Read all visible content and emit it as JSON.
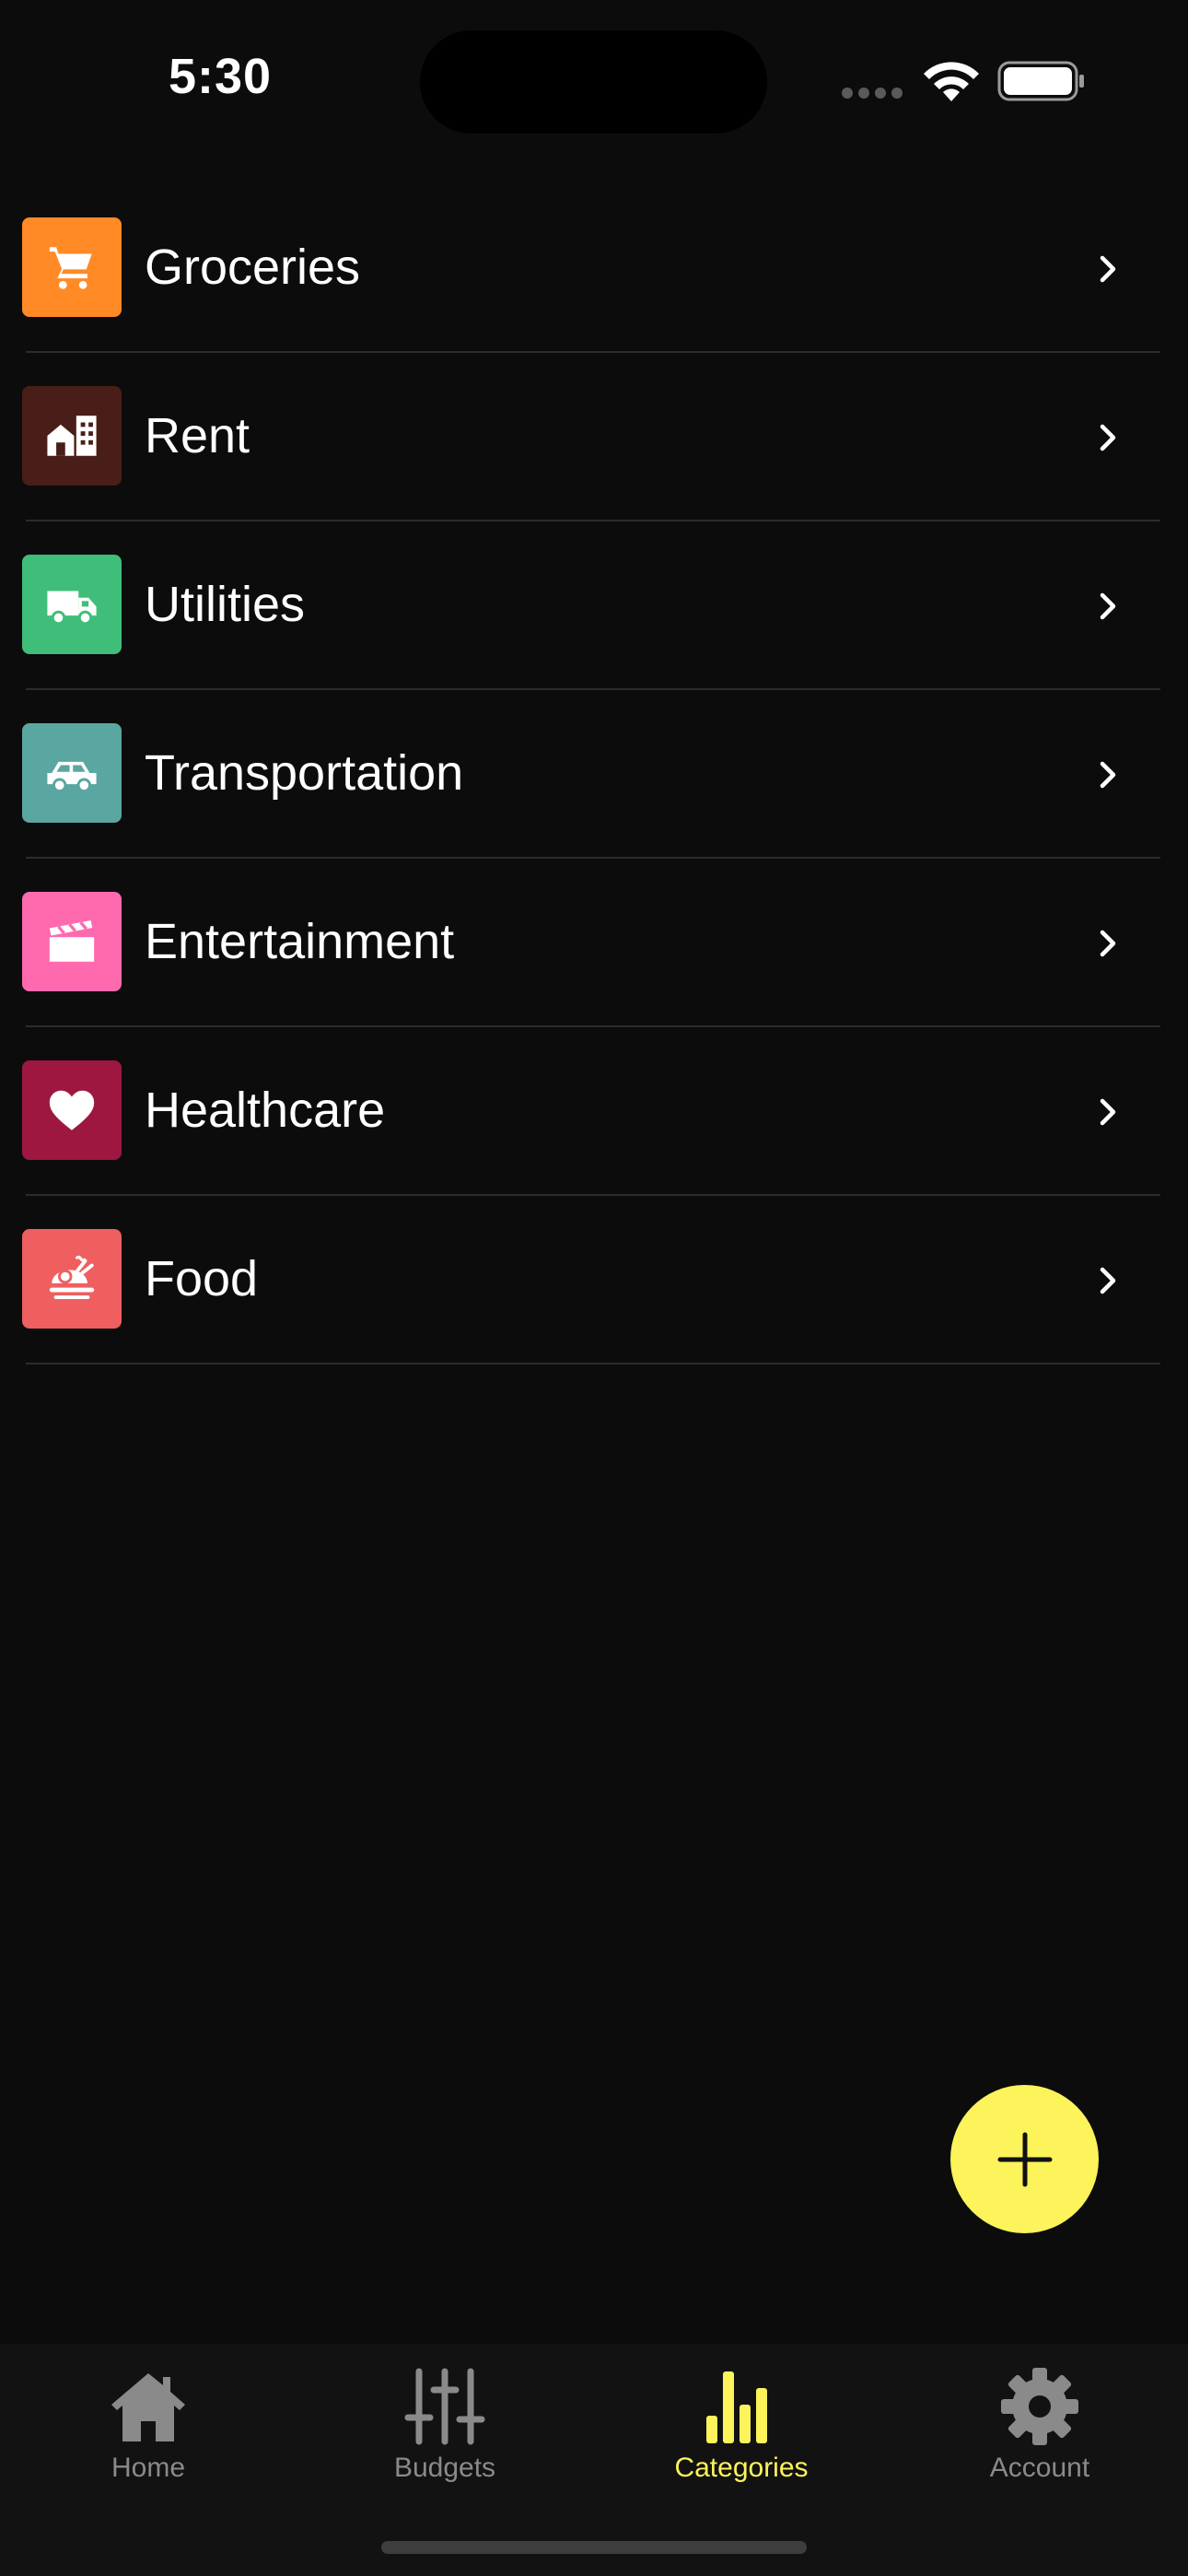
{
  "status_bar": {
    "time": "5:30"
  },
  "categories": [
    {
      "label": "Groceries",
      "icon": "shopping-cart-icon",
      "color": "#ff8a26"
    },
    {
      "label": "Rent",
      "icon": "building-icon",
      "color": "#4a1e18"
    },
    {
      "label": "Utilities",
      "icon": "truck-icon",
      "color": "#3fbe79"
    },
    {
      "label": "Transportation",
      "icon": "car-icon",
      "color": "#5aa6a0"
    },
    {
      "label": "Entertainment",
      "icon": "clapperboard-icon",
      "color": "#ff6aaf"
    },
    {
      "label": "Healthcare",
      "icon": "heart-icon",
      "color": "#9d1740"
    },
    {
      "label": "Food",
      "icon": "roast-chicken-icon",
      "color": "#ef5f5f"
    }
  ],
  "fab": {
    "icon": "plus-icon",
    "color": "#fdf35a"
  },
  "tabs": [
    {
      "label": "Home",
      "icon": "home-icon",
      "active": false
    },
    {
      "label": "Budgets",
      "icon": "sliders-icon",
      "active": false
    },
    {
      "label": "Categories",
      "icon": "bar-chart-icon",
      "active": true
    },
    {
      "label": "Account",
      "icon": "gear-icon",
      "active": false
    }
  ],
  "colors": {
    "background": "#0c0c0c",
    "accent": "#fdf35a",
    "tab_inactive": "#8a8a8a"
  }
}
